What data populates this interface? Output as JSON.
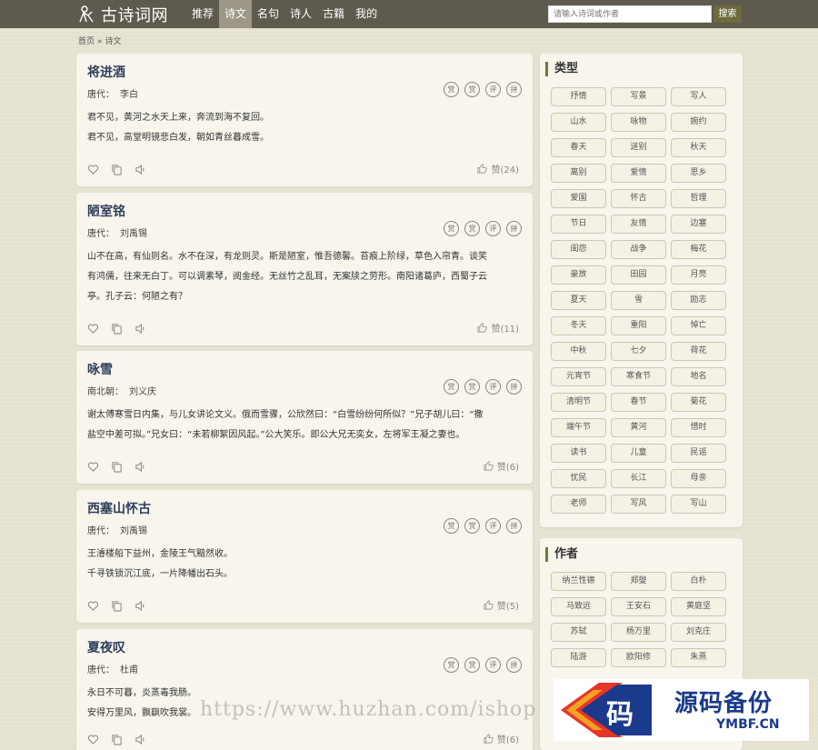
{
  "header": {
    "site_name": "古诗词网",
    "nav": [
      "推荐",
      "诗文",
      "名句",
      "诗人",
      "古籍",
      "我的"
    ],
    "active_nav": 1,
    "search_placeholder": "请输入诗词或作者",
    "search_button": "搜索"
  },
  "breadcrumb": {
    "home": "首页",
    "separator": "»",
    "current": "诗文"
  },
  "tool_labels": [
    "赏",
    "赏",
    "评",
    "拼"
  ],
  "poems": [
    {
      "title": "将进酒",
      "dynasty": "唐代：",
      "author": "李白",
      "lines": [
        "君不见，黄河之水天上来，奔流到海不复回。",
        "君不见，高堂明镜悲白发，朝如青丝暮成雪。"
      ],
      "likes": "赞(24)"
    },
    {
      "title": "陋室铭",
      "dynasty": "唐代：",
      "author": "刘禹锡",
      "lines": [
        "山不在高，有仙则名。水不在深，有龙则灵。斯是陋室，惟吾德馨。苔痕上阶绿，草色入帘青。谈笑",
        "有鸿儒，往来无白丁。可以调素琴，阅金经。无丝竹之乱耳，无案牍之劳形。南阳诸葛庐，西蜀子云",
        "亭。孔子云：何陋之有？"
      ],
      "likes": "赞(11)"
    },
    {
      "title": "咏雪",
      "dynasty": "南北朝：",
      "author": "刘义庆",
      "lines": [
        "谢太傅寒雪日内集，与儿女讲论文义。俄而雪骤，公欣然曰：“白雪纷纷何所似？”兄子胡儿曰：“撒",
        "盐空中差可拟。”兄女曰：“未若柳絮因风起。”公大笑乐。即公大兄无奕女，左将军王凝之妻也。"
      ],
      "likes": "赞(6)"
    },
    {
      "title": "西塞山怀古",
      "dynasty": "唐代：",
      "author": "刘禹锡",
      "lines": [
        "王濬楼船下益州，金陵王气黯然收。",
        "千寻铁锁沉江底，一片降幡出石头。"
      ],
      "likes": "赞(5)"
    },
    {
      "title": "夏夜叹",
      "dynasty": "唐代：",
      "author": "杜甫",
      "lines": [
        "永日不可暮，炎蒸毒我肠。",
        "安得万里风，飘飖吹我裳。"
      ],
      "likes": "赞(6)"
    }
  ],
  "sidebar": {
    "types_title": "类型",
    "types": [
      "抒情",
      "写景",
      "写人",
      "山水",
      "咏物",
      "婉约",
      "春天",
      "送别",
      "秋天",
      "离别",
      "爱情",
      "思乡",
      "爱国",
      "怀古",
      "哲理",
      "节日",
      "友情",
      "边塞",
      "闺怨",
      "战争",
      "梅花",
      "豪放",
      "田园",
      "月亮",
      "夏天",
      "雪",
      "励志",
      "冬天",
      "重阳",
      "悼亡",
      "中秋",
      "七夕",
      "荷花",
      "元宵节",
      "寒食节",
      "地名",
      "清明节",
      "春节",
      "菊花",
      "端午节",
      "黄河",
      "惜时",
      "读书",
      "儿童",
      "民谣",
      "忧民",
      "长江",
      "母亲",
      "老师",
      "写风",
      "写山"
    ],
    "authors_title": "作者",
    "authors": [
      "纳兰性德",
      "郑燮",
      "白朴",
      "马致远",
      "王安石",
      "黄庭坚",
      "苏轼",
      "杨万里",
      "刘克庄",
      "陆游",
      "欧阳修",
      "朱熹"
    ]
  },
  "watermark": {
    "url": "https://www.huzhan.com/ishop",
    "brand_char": "码",
    "brand_name": "源码备份",
    "brand_domain": "YMBF.CN"
  },
  "colors": {
    "topbar": "#5e5a4d",
    "active_nav": "#9c9786",
    "search_button": "#6e6a3e",
    "title": "#2e3e5c",
    "side_accent": "#6b7b35"
  }
}
